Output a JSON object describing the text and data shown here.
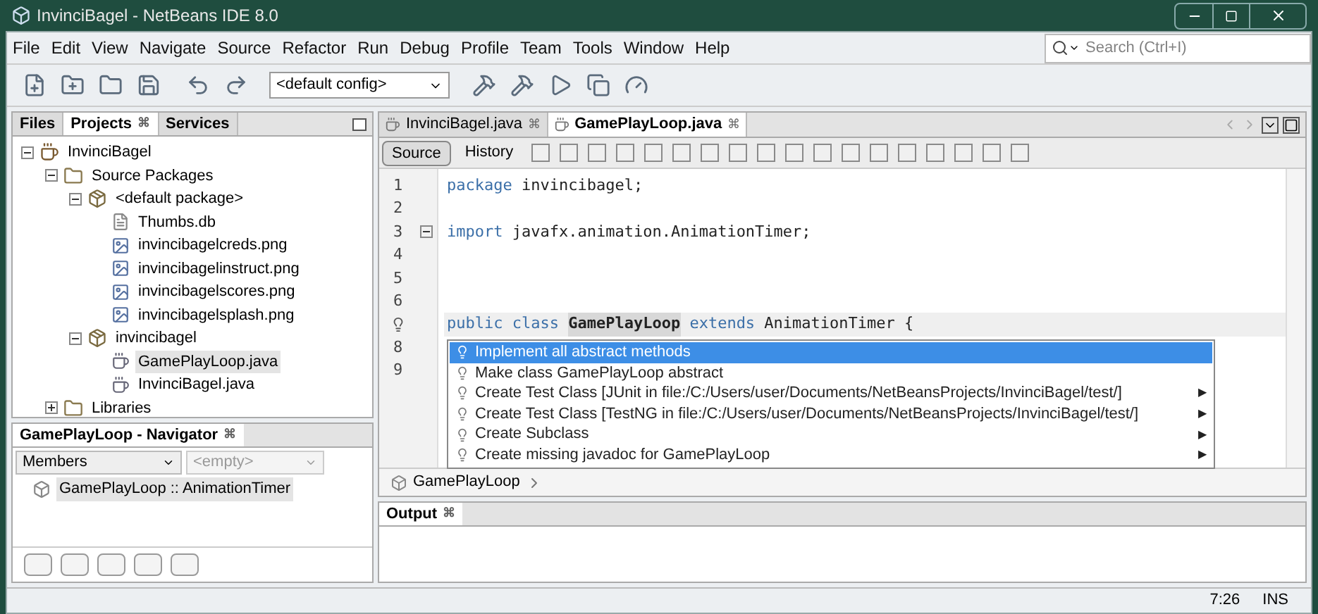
{
  "window": {
    "title": "InvinciBagel - NetBeans IDE 8.0"
  },
  "menu": [
    "File",
    "Edit",
    "View",
    "Navigate",
    "Source",
    "Refactor",
    "Run",
    "Debug",
    "Profile",
    "Team",
    "Tools",
    "Window",
    "Help"
  ],
  "search": {
    "placeholder": "Search (Ctrl+I)"
  },
  "config": {
    "value": "<default config>"
  },
  "project_tabs": [
    {
      "label": "Files",
      "selected": false
    },
    {
      "label": "Projects",
      "selected": true,
      "close": "⌘"
    },
    {
      "label": "Services",
      "selected": false
    }
  ],
  "tree": [
    {
      "label": "InvinciBagel",
      "kind": "project",
      "expanded": true,
      "selected": false,
      "children": [
        {
          "label": "Source Packages",
          "kind": "folder",
          "expanded": true,
          "selected": false,
          "children": [
            {
              "label": "<default package>",
              "kind": "package",
              "expanded": true,
              "selected": false,
              "children": [
                {
                  "label": "Thumbs.db",
                  "kind": "file",
                  "selected": false
                },
                {
                  "label": "invincibagelcreds.png",
                  "kind": "image",
                  "selected": false
                },
                {
                  "label": "invincibagelinstruct.png",
                  "kind": "image",
                  "selected": false
                },
                {
                  "label": "invincibagelscores.png",
                  "kind": "image",
                  "selected": false
                },
                {
                  "label": "invincibagelsplash.png",
                  "kind": "image",
                  "selected": false
                }
              ]
            },
            {
              "label": "invincibagel",
              "kind": "package",
              "expanded": true,
              "selected": false,
              "children": [
                {
                  "label": "GamePlayLoop.java",
                  "kind": "java",
                  "selected": true
                },
                {
                  "label": "InvinciBagel.java",
                  "kind": "java",
                  "selected": false
                }
              ]
            }
          ]
        },
        {
          "label": "Libraries",
          "kind": "folder",
          "expanded": false,
          "selected": false
        }
      ]
    }
  ],
  "navigator": {
    "title": "GamePlayLoop - Navigator",
    "close": "⌘",
    "filter": "Members",
    "scope": {
      "placeholder": "<empty>"
    },
    "items": [
      {
        "label": "GamePlayLoop :: AnimationTimer",
        "selected": true
      }
    ]
  },
  "editor_tabs": [
    {
      "label": "InvinciBagel.java",
      "selected": false,
      "close": "⌘"
    },
    {
      "label": "GamePlayLoop.java",
      "selected": true,
      "close": "⌘"
    }
  ],
  "view_tabs": [
    {
      "label": "Source",
      "selected": true
    },
    {
      "label": "History",
      "selected": false
    }
  ],
  "code": [
    {
      "number": "1",
      "segments": [
        {
          "text": "package",
          "kind": "keyword"
        },
        {
          "text": " invincibagel;",
          "kind": "plain"
        }
      ]
    },
    {
      "number": "2"
    },
    {
      "number": "3",
      "fold": true,
      "segments": [
        {
          "text": "import",
          "kind": "keyword"
        },
        {
          "text": " javafx.animation.AnimationTimer;",
          "kind": "plain"
        }
      ]
    },
    {
      "number": "4"
    },
    {
      "number": "5"
    },
    {
      "number": "6"
    },
    {
      "hint": true,
      "current": true,
      "segments": [
        {
          "text": "public class ",
          "kind": "keyword"
        },
        {
          "text": "GamePlayLoop",
          "kind": "highlight"
        },
        {
          "text": " extends",
          "kind": "keyword"
        },
        {
          "text": " AnimationTimer {",
          "kind": "plain"
        }
      ]
    },
    {
      "number": "8"
    },
    {
      "number": "9"
    }
  ],
  "hints": [
    {
      "label": "Implement all abstract methods",
      "selected": true
    },
    {
      "label": "Make class GamePlayLoop abstract",
      "selected": false
    },
    {
      "label": "Create Test Class [JUnit in file:/C:/Users/user/Documents/NetBeansProjects/InvinciBagel/test/]",
      "selected": false,
      "arrow": "▶"
    },
    {
      "label": "Create Test Class [TestNG in file:/C:/Users/user/Documents/NetBeansProjects/InvinciBagel/test/]",
      "selected": false,
      "arrow": "▶"
    },
    {
      "label": "Create Subclass",
      "selected": false,
      "arrow": "▶"
    },
    {
      "label": "Create missing javadoc for GamePlayLoop",
      "selected": false,
      "arrow": "▶"
    }
  ],
  "breadcrumb": "GamePlayLoop",
  "output": {
    "title": "Output",
    "close": "⌘"
  },
  "status_bar": {
    "position": "7:26",
    "mode": "INS"
  }
}
